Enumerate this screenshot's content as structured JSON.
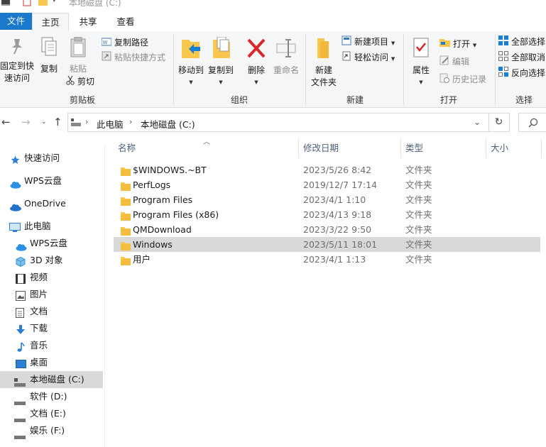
{
  "window": {
    "title": "本地磁盘 (C:)"
  },
  "tabs": {
    "file": "文件",
    "home": "主页",
    "share": "共享",
    "view": "查看"
  },
  "ribbon": {
    "clipboard": {
      "pin_line1": "固定到快",
      "pin_line2": "速访问",
      "copy": "复制",
      "paste": "粘贴",
      "copy_path": "复制路径",
      "paste_shortcut": "粘贴快捷方式",
      "cut": "剪切",
      "group": "剪贴板"
    },
    "organize": {
      "move_to": "移动到",
      "copy_to": "复制到",
      "delete": "删除",
      "rename": "重命名",
      "group": "组织"
    },
    "new": {
      "new_folder_line1": "新建",
      "new_folder_line2": "文件夹",
      "new_item": "新建项目",
      "easy_access": "轻松访问",
      "group": "新建"
    },
    "open": {
      "properties": "属性",
      "open": "打开",
      "edit": "编辑",
      "history": "历史记录",
      "group": "打开"
    },
    "select": {
      "select_all": "全部选择",
      "select_none": "全部取消",
      "invert": "反向选择",
      "group": "选择"
    }
  },
  "address": {
    "crumbs": [
      "此电脑",
      "本地磁盘 (C:)"
    ]
  },
  "sidebar": {
    "items": [
      {
        "label": "快速访问",
        "icon": "star-icon"
      },
      {
        "label": "WPS云盘",
        "icon": "cloud-icon"
      },
      {
        "label": "OneDrive",
        "icon": "onedrive-icon"
      },
      {
        "label": "此电脑",
        "icon": "pc-icon"
      },
      {
        "label": "WPS云盘",
        "icon": "cloud-icon"
      },
      {
        "label": "3D 对象",
        "icon": "cube-icon"
      },
      {
        "label": "视频",
        "icon": "video-icon"
      },
      {
        "label": "图片",
        "icon": "picture-icon"
      },
      {
        "label": "文档",
        "icon": "document-icon"
      },
      {
        "label": "下载",
        "icon": "download-icon"
      },
      {
        "label": "音乐",
        "icon": "music-icon"
      },
      {
        "label": "桌面",
        "icon": "desktop-icon"
      },
      {
        "label": "本地磁盘 (C:)",
        "icon": "drive-icon"
      },
      {
        "label": "软件 (D:)",
        "icon": "drive-icon"
      },
      {
        "label": "文档 (E:)",
        "icon": "drive-icon"
      },
      {
        "label": "娱乐 (F:)",
        "icon": "drive-icon"
      }
    ]
  },
  "columns": {
    "name": "名称",
    "date": "修改日期",
    "type": "类型",
    "size": "大小"
  },
  "files": [
    {
      "name": "$WINDOWS.~BT",
      "date": "2023/5/26 8:42",
      "type": "文件夹"
    },
    {
      "name": "PerfLogs",
      "date": "2019/12/7 17:14",
      "type": "文件夹"
    },
    {
      "name": "Program Files",
      "date": "2023/4/1 1:10",
      "type": "文件夹"
    },
    {
      "name": "Program Files (x86)",
      "date": "2023/4/13 9:18",
      "type": "文件夹"
    },
    {
      "name": "QMDownload",
      "date": "2023/3/22 9:50",
      "type": "文件夹"
    },
    {
      "name": "Windows",
      "date": "2023/5/11 18:01",
      "type": "文件夹"
    },
    {
      "name": "用户",
      "date": "2023/4/1 1:13",
      "type": "文件夹"
    }
  ],
  "colors": {
    "accent": "#1979ca",
    "selection": "#d9d9d9",
    "folder": "#f8c74e"
  }
}
